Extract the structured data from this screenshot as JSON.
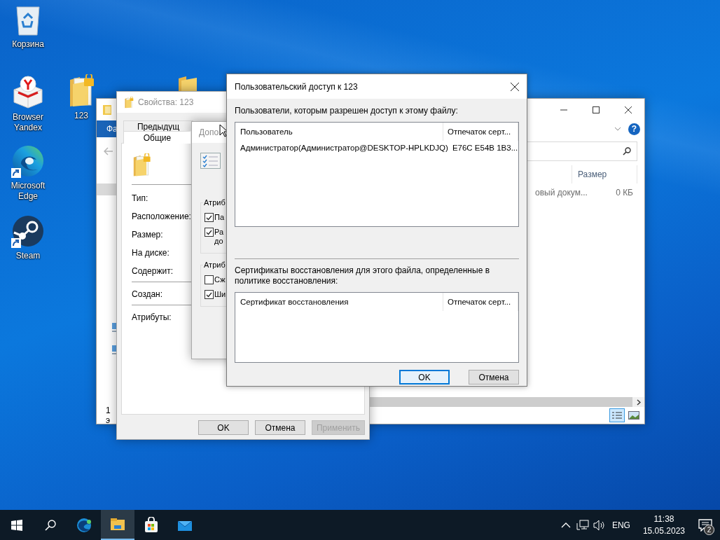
{
  "desktop_icons": [
    {
      "kind": "recycle-bin",
      "label": "Корзина",
      "shortcut": false
    },
    {
      "kind": "yandex",
      "label": "Browser Yandex",
      "shortcut": false
    },
    {
      "kind": "edge",
      "label": "Microsoft Edge",
      "shortcut": true
    },
    {
      "kind": "steam",
      "label": "Steam",
      "shortcut": true
    },
    {
      "kind": "locked-folder",
      "label": "123",
      "shortcut": false
    },
    {
      "kind": "folder",
      "shortcut": false
    }
  ],
  "explorer": {
    "ribbon_tab": "Фа",
    "help": "?",
    "column_header": "Размер",
    "file": {
      "type": "овый докум...",
      "size": "0 КБ"
    },
    "status": "1 э"
  },
  "properties": {
    "title": "Свойства: 123",
    "tabs": [
      {
        "label": "Предыдущ",
        "selected": false
      },
      {
        "label": "Общие",
        "selected": true
      }
    ],
    "field_groups": [
      [
        "Тип:",
        "Расположение:",
        "Размер:",
        "На диске:",
        "Содержит:"
      ],
      [
        "Создан:"
      ],
      [
        "Атрибуты:"
      ]
    ],
    "buttons": [
      {
        "label": "OK",
        "disabled": false
      },
      {
        "label": "Отмена",
        "disabled": false
      },
      {
        "label": "Применить",
        "disabled": true
      }
    ]
  },
  "advanced": {
    "title": "Допо",
    "groups": [
      {
        "title": "Атриб",
        "options": [
          {
            "label": "Па",
            "checked": true
          },
          {
            "label": "Ра до",
            "checked": true
          }
        ]
      },
      {
        "title": "Атриб",
        "options": [
          {
            "label": "Сж",
            "checked": false
          },
          {
            "label": "Ши",
            "checked": true
          }
        ]
      }
    ]
  },
  "dialog": {
    "title": "Пользовательский доступ к 123",
    "users_label": "Пользователи, которым разрешен доступ к этому файлу:",
    "users_table": {
      "columns": [
        "Пользователь",
        "Отпечаток серт..."
      ],
      "rows": [
        [
          "Администратор(Администратор@DESKTOP-HPLKDJQ)",
          "E76C E54B 1B3..."
        ]
      ]
    },
    "recovery_label": "Сертификаты восстановления для этого файла, определенные в политике восстановления:",
    "recovery_table": {
      "columns": [
        "Сертификат восстановления",
        "Отпечаток серт..."
      ]
    },
    "buttons": [
      {
        "label": "OK",
        "default": true
      },
      {
        "label": "Отмена",
        "default": false
      }
    ]
  },
  "taskbar": {
    "apps": [
      {
        "kind": "edge",
        "selected": false
      },
      {
        "kind": "explorer",
        "selected": true
      },
      {
        "kind": "store",
        "selected": false
      },
      {
        "kind": "mail",
        "selected": false
      }
    ],
    "language": "ENG",
    "time": "11:38",
    "date": "15.05.2023",
    "notification_count": "2"
  }
}
